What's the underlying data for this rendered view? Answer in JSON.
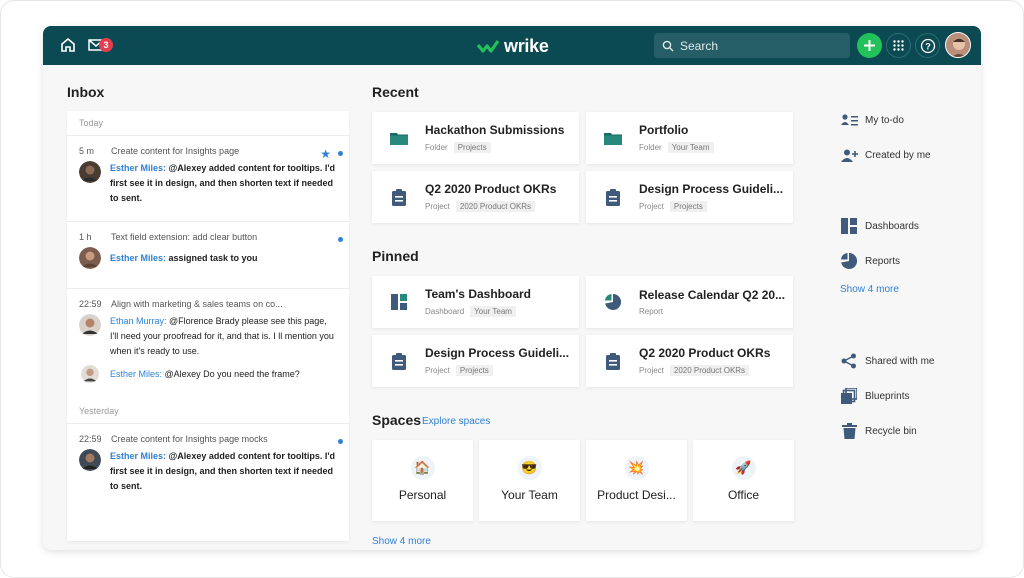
{
  "topbar": {
    "logo_text": "wrike",
    "search_placeholder": "Search",
    "mail_count": "3",
    "colors": {
      "bar": "#0b4a52",
      "accent": "#23c15a",
      "link": "#2f80d7"
    }
  },
  "inbox": {
    "title": "Inbox",
    "today_label": "Today",
    "yesterday_label": "Yesterday",
    "messages": [
      {
        "time": "5 m",
        "subject": "Create content for Insights page",
        "author": "Esther Miles:",
        "text": " @Alexey added content for tooltips. I'd first see it in design, and then shorten text if needed to sent."
      },
      {
        "time": "1 h",
        "subject": "Text field extension: add clear button",
        "author": "Esther Miles:",
        "text": " assigned task to you"
      },
      {
        "time": "22:59",
        "subject": "Align with marketing & sales teams on co...",
        "author": "Ethan Murray:",
        "text": " @Florence Brady please see this page, I'll need your proofread for it, and that is. I ll mention you when it's ready to use.",
        "author2": "Esther Miles:",
        "text2": " @Alexey Do you need the frame?"
      },
      {
        "time": "22:59",
        "subject": "Create content for Insights page mocks",
        "author": "Esther Miles:",
        "text": " @Alexey added content for tooltips. I'd first see it in design, and then shorten text if needed to sent."
      }
    ]
  },
  "recent": {
    "title": "Recent",
    "items": [
      {
        "title": "Hackathon Submissions",
        "kind": "Folder",
        "tag": "Projects",
        "icon": "folder-icon"
      },
      {
        "title": "Portfolio",
        "kind": "Folder",
        "tag": "Your Team",
        "icon": "folder-icon"
      },
      {
        "title": "Q2 2020 Product OKRs",
        "kind": "Project",
        "tag": "2020 Product OKRs",
        "icon": "project-icon"
      },
      {
        "title": "Design Process Guideli...",
        "kind": "Project",
        "tag": "Projects",
        "icon": "project-icon"
      }
    ]
  },
  "pinned": {
    "title": "Pinned",
    "items": [
      {
        "title": "Team's Dashboard",
        "kind": "Dashboard",
        "tag": "Your Team",
        "icon": "dashboard-icon"
      },
      {
        "title": "Release Calendar Q2 20...",
        "kind": "Report",
        "tag": "",
        "icon": "report-icon"
      },
      {
        "title": "Design Process Guideli...",
        "kind": "Project",
        "tag": "Projects",
        "icon": "project-icon"
      },
      {
        "title": "Q2 2020 Product OKRs",
        "kind": "Project",
        "tag": "2020 Product OKRs",
        "icon": "project-icon"
      }
    ]
  },
  "spaces": {
    "title": "Spaces",
    "explore_label": "Explore spaces",
    "show_more": "Show 4 more",
    "items": [
      {
        "label": "Personal",
        "emoji": "🏠"
      },
      {
        "label": "Your Team",
        "emoji": "😎"
      },
      {
        "label": "Product Desi...",
        "emoji": "💥"
      },
      {
        "label": "Office",
        "emoji": "🚀"
      }
    ]
  },
  "right": {
    "my_todo": "My to-do",
    "created_by_me": "Created by me",
    "dashboards": "Dashboards",
    "reports": "Reports",
    "show_more": "Show 4 more",
    "shared_with_me": "Shared with me",
    "blueprints": "Blueprints",
    "recycle_bin": "Recycle bin"
  }
}
